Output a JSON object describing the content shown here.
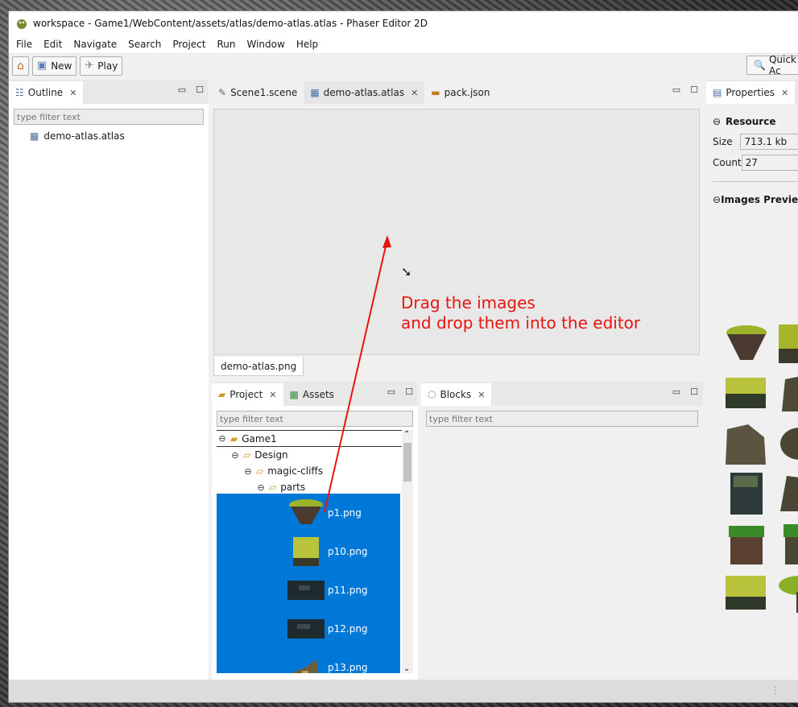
{
  "window": {
    "title": "workspace - Game1/WebContent/assets/atlas/demo-atlas.atlas - Phaser Editor 2D"
  },
  "menu": [
    "File",
    "Edit",
    "Navigate",
    "Search",
    "Project",
    "Run",
    "Window",
    "Help"
  ],
  "toolbar": {
    "new_label": "New",
    "play_label": "Play",
    "quick_access": "Quick Ac"
  },
  "outline": {
    "tab_label": "Outline",
    "filter_placeholder": "type filter text",
    "item": "demo-atlas.atlas"
  },
  "editor": {
    "tabs": [
      {
        "label": "Scene1.scene"
      },
      {
        "label": "demo-atlas.atlas"
      },
      {
        "label": "pack.json"
      }
    ],
    "bottom_tab": "demo-atlas.png",
    "annotation_line1": "Drag the images",
    "annotation_line2": "and drop them into the editor",
    "annotation_color": "#e8140e"
  },
  "project": {
    "tab_label": "Project",
    "assets_tab_label": "Assets",
    "filter_placeholder": "type filter text",
    "tree": {
      "root": "Game1",
      "folder1": "Design",
      "folder2": "magic-cliffs",
      "folder3": "parts",
      "files": [
        "p1.png",
        "p10.png",
        "p11.png",
        "p12.png",
        "p13.png"
      ]
    },
    "selection_color": "#0078d7"
  },
  "blocks": {
    "tab_label": "Blocks",
    "filter_placeholder": "type filter text"
  },
  "properties": {
    "tab_label": "Properties",
    "resource_section": "Resource",
    "size_label": "Size",
    "size_value": "713.1 kb",
    "count_label": "Count",
    "count_value": "27",
    "preview_section": "Images Preview"
  }
}
